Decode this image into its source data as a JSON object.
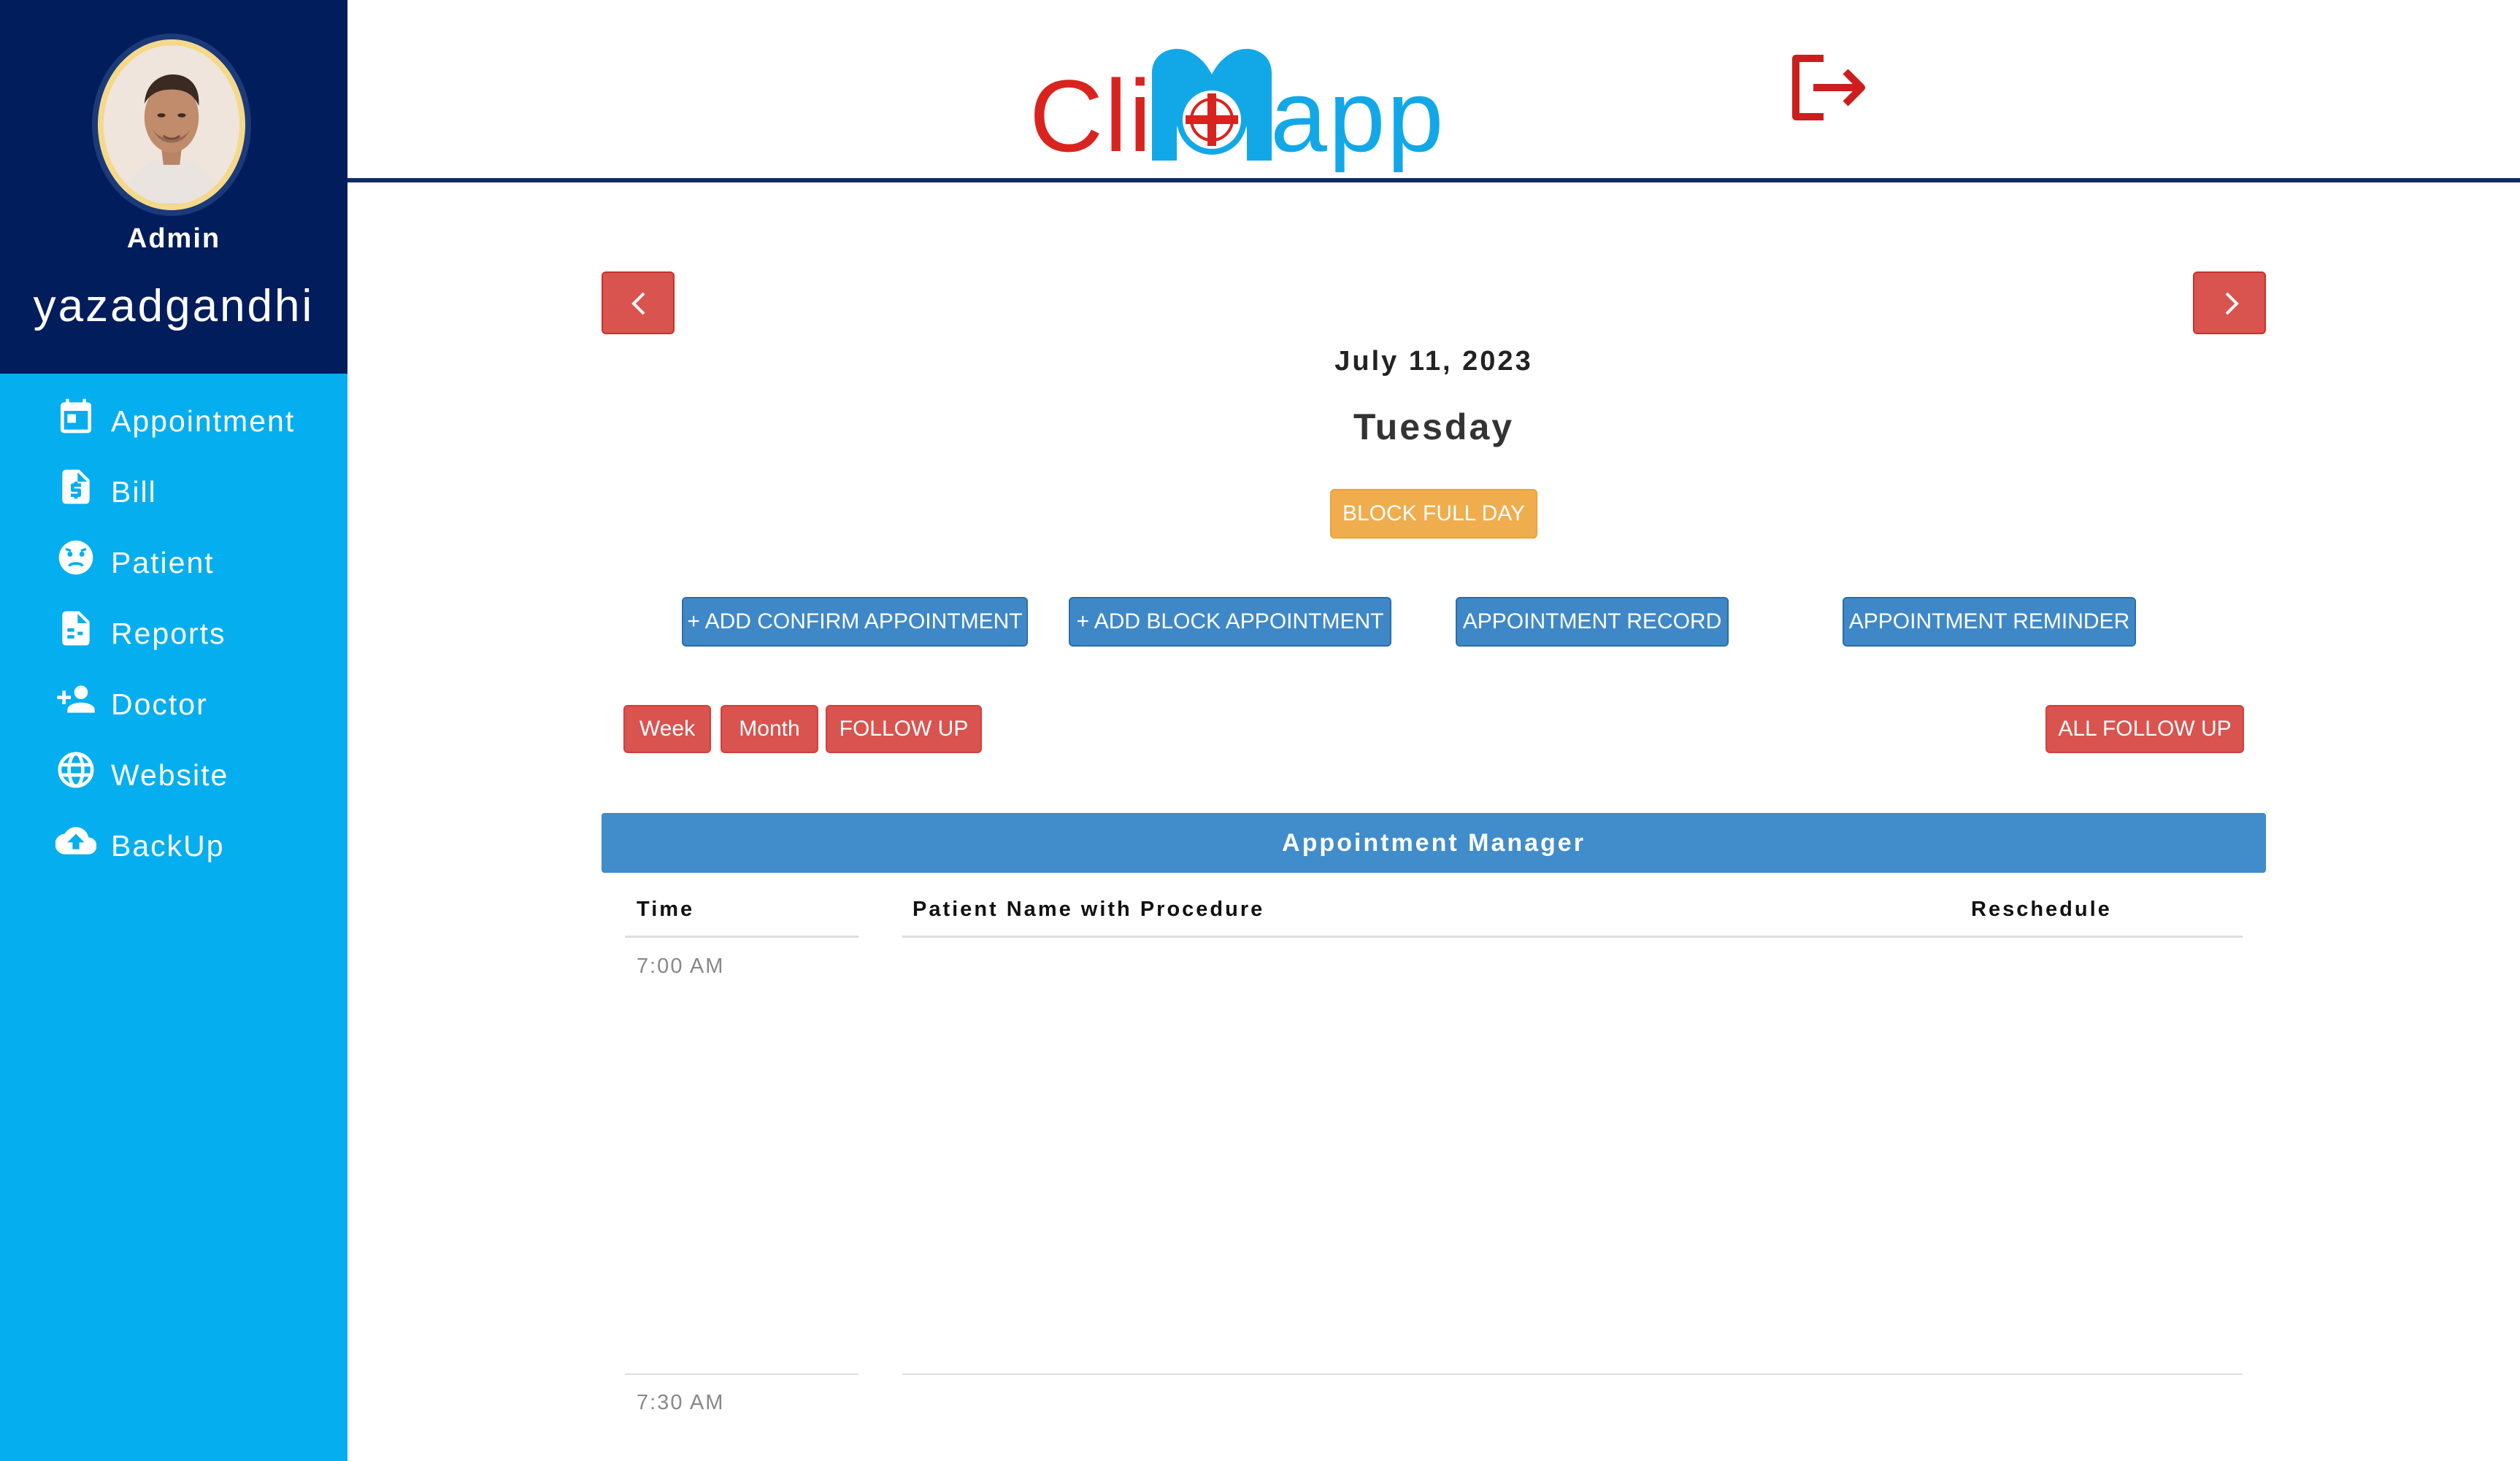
{
  "profile": {
    "role": "Admin",
    "username": "yazadgandhi"
  },
  "sidebar": {
    "items": [
      {
        "label": "Appointment",
        "icon": "calendar-icon"
      },
      {
        "label": "Bill",
        "icon": "invoice-icon"
      },
      {
        "label": "Patient",
        "icon": "patient-face-icon"
      },
      {
        "label": "Reports",
        "icon": "report-icon"
      },
      {
        "label": "Doctor",
        "icon": "add-person-icon"
      },
      {
        "label": "Website",
        "icon": "globe-icon"
      },
      {
        "label": "BackUp",
        "icon": "cloud-upload-icon"
      }
    ]
  },
  "header": {
    "logo_left": "Cli",
    "logo_right": "app",
    "logout_icon": "logout-icon"
  },
  "day": {
    "date": "July 11, 2023",
    "weekday": "Tuesday"
  },
  "actions": {
    "block_full_day": "BLOCK FULL DAY",
    "add_confirm": "+ ADD CONFIRM APPOINTMENT",
    "add_block": "+ ADD BLOCK APPOINTMENT",
    "record": "APPOINTMENT RECORD",
    "reminder": "APPOINTMENT REMINDER",
    "week": "Week",
    "month": "Month",
    "follow_up": "FOLLOW UP",
    "all_follow_up": "ALL FOLLOW UP"
  },
  "manager": {
    "title": "Appointment Manager",
    "columns": {
      "time": "Time",
      "patient": "Patient Name with Procedure",
      "reschedule": "Reschedule"
    },
    "slots": [
      "7:00 AM",
      "7:30 AM"
    ]
  },
  "colors": {
    "sidebar": "#05aeee",
    "profile_bg": "#021d5c",
    "danger": "#d9534f",
    "primary": "#3f88c8",
    "warning": "#efad4e",
    "logo_red": "#d9231f",
    "logo_blue": "#12a8e8"
  }
}
